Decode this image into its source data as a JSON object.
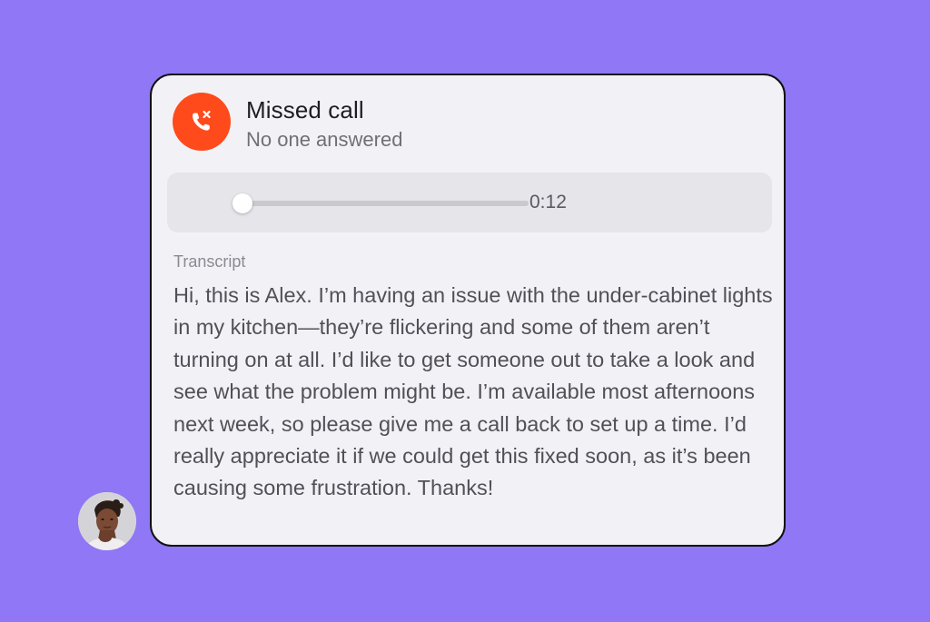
{
  "colors": {
    "background": "#8f77f5",
    "card": "#f2f2f6",
    "missed_call_accent": "#ff4a1c"
  },
  "call": {
    "icon": "missed-call-icon",
    "title": "Missed call",
    "subtitle": "No one answered"
  },
  "audio": {
    "progress_fraction": 0,
    "duration": "0:12"
  },
  "transcript": {
    "label": "Transcript",
    "text": "Hi, this is Alex. I’m having an issue with the under-cabinet lights in my kitchen—they’re flickering and some of them aren’t turning on at all. I’d like to get someone out to take a look and see what the problem might be. I’m available most afternoons next week, so please give me a call back to set up a time. I’d really appreciate it if we could get this fixed soon, as it’s been causing some frustration. Thanks!"
  },
  "caller": {
    "avatar": "caller-avatar"
  }
}
